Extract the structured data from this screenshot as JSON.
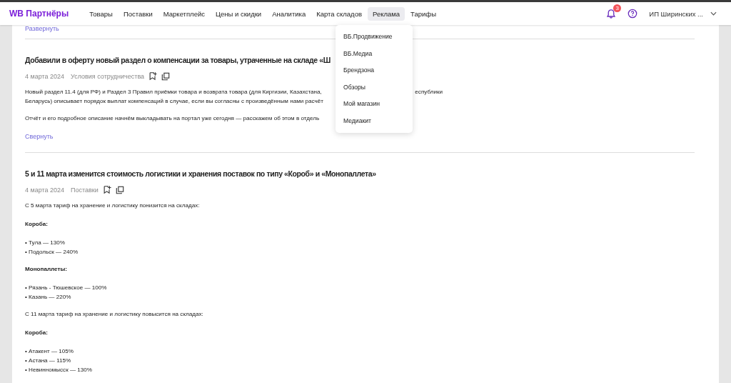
{
  "header": {
    "logo": "WB Партнёры",
    "nav": [
      {
        "label": "Товары",
        "selected": false
      },
      {
        "label": "Поставки",
        "selected": false
      },
      {
        "label": "Маркетплейс",
        "selected": false
      },
      {
        "label": "Цены и скидки",
        "selected": false
      },
      {
        "label": "Аналитика",
        "selected": false
      },
      {
        "label": "Карта складов",
        "selected": false
      },
      {
        "label": "Реклама",
        "selected": true
      },
      {
        "label": "Тарифы",
        "selected": false
      }
    ],
    "notifications": {
      "count": "3"
    },
    "account": "ИП Ширинских ..."
  },
  "dropdown": {
    "items": [
      "ВБ.Продвижение",
      "ВБ.Медиа",
      "Брендзона",
      "Обзоры",
      "Мой магазин",
      "Медиакит"
    ]
  },
  "feed": {
    "top_link": "Развернуть",
    "articles": [
      {
        "title": "Добавили в оферту новый раздел о компенсации за товары, утраченные на складе «Ш",
        "date": "4 марта 2024",
        "category": "Условия сотрудничества",
        "toggle": "Свернуть",
        "body": [
          {
            "kind": "lines",
            "lines": [
              {
                "left": "Новый раздел 11.4 (для РФ) и Раздел 3 Правил приёмки товара и возврата товара (для Киргизии, Казахстана,",
                "right": "еспублики"
              },
              {
                "left": "Беларусь) описывает порядок выплат компенсаций в случае, если вы согласны с произведённым нами расчёт"
              }
            ]
          },
          {
            "kind": "p",
            "text": "Отчёт и его подробное описание начнём выкладывать на портал уже сегодня — расскажем об этом в отдель"
          }
        ]
      },
      {
        "title": "5 и 11 марта изменится стоимость логистики и хранения поставок по типу «Короб» и «Монопаллета»",
        "date": "4 марта 2024",
        "category": "Поставки",
        "body": [
          {
            "kind": "p",
            "text": "С 5 марта тариф на хранение и логистику понизится на складах:"
          },
          {
            "kind": "h",
            "text": "Короба:"
          },
          {
            "kind": "list",
            "items": [
              "• Тула — 130%",
              "• Подольск — 240%"
            ]
          },
          {
            "kind": "h",
            "text": "Монопаллеты:"
          },
          {
            "kind": "list",
            "items": [
              "• Рязань - Тюшевское — 100%",
              "• Казань — 220%"
            ]
          },
          {
            "kind": "p",
            "text": "С 11 марта тариф на хранение и логистику повысится на складах:"
          },
          {
            "kind": "h",
            "text": "Короба:"
          },
          {
            "kind": "list",
            "items": [
              "• Атакент — 105%",
              "• Астана — 115%",
              "• Невинномысск — 130%"
            ]
          }
        ]
      }
    ]
  }
}
